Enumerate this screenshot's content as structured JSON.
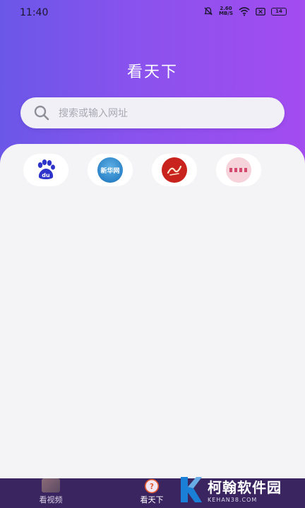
{
  "status_bar": {
    "time": "11:40",
    "net_speed_value": "2.60",
    "net_speed_unit": "MB/S",
    "battery": "14",
    "icons": [
      "bell-muted-icon",
      "wifi-icon",
      "sim-icon",
      "battery-icon"
    ]
  },
  "header": {
    "title": "看天下"
  },
  "search": {
    "placeholder": "搜索或输入网址",
    "icon": "search-icon"
  },
  "shortcuts": [
    {
      "name": "baidu",
      "icon": "baidu-paw-icon",
      "logo_text": "du"
    },
    {
      "name": "xinhua",
      "icon": "xinhuanet-logo",
      "logo_text": "新华网"
    },
    {
      "name": "xuexi",
      "icon": "xuexi-logo"
    },
    {
      "name": "pink-site",
      "icon": "pink-site-logo"
    }
  ],
  "tab_bar": {
    "tabs": [
      {
        "label": "看视频",
        "icon": "video-icon",
        "active": false
      },
      {
        "label": "看天下",
        "icon": "world-icon",
        "active": true
      }
    ]
  },
  "watermark": {
    "cn": "柯翰软件园",
    "en": "KEHAN38.COM"
  },
  "colors": {
    "header_start": "#6a57e8",
    "header_end": "#a34cf0",
    "tab_bar": "#3a2560",
    "content_bg": "#f4f4f6"
  }
}
